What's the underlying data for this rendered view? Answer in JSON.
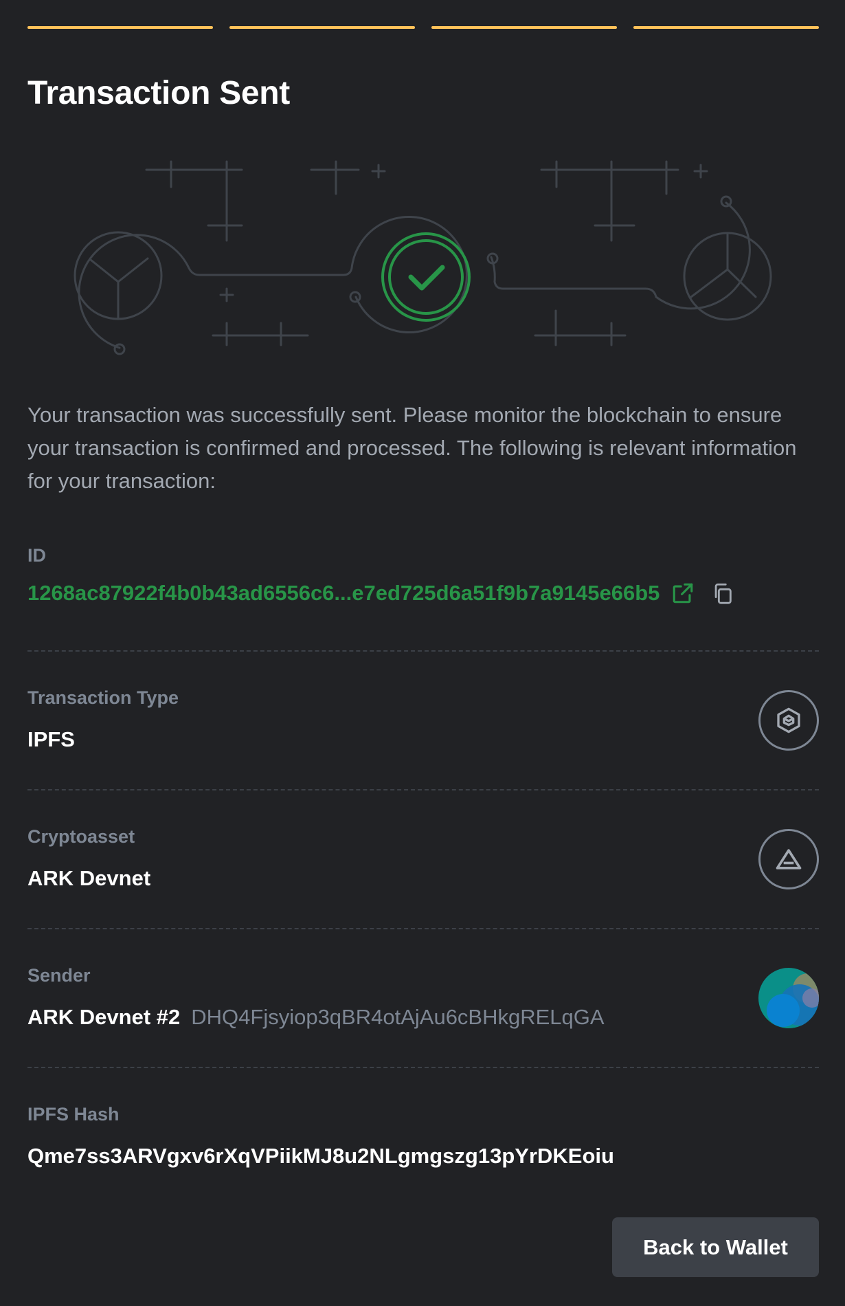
{
  "header": {
    "title": "Transaction Sent",
    "steps_completed": 4,
    "steps_total": 4,
    "step_color": "#ffc35a"
  },
  "description": "Your transaction was successfully sent. Please monitor the blockchain to ensure your transaction is confirmed and processed. The following is relevant information for your transaction:",
  "details": {
    "id": {
      "label": "ID",
      "value": "1268ac87922f4b0b43ad6556c6...e7ed725d6a51f9b7a9145e66b5",
      "icons": [
        "external-link-icon",
        "copy-icon"
      ]
    },
    "type": {
      "label": "Transaction Type",
      "value": "IPFS",
      "icon": "ipfs-cube-icon"
    },
    "cryptoasset": {
      "label": "Cryptoasset",
      "value": "ARK Devnet",
      "icon": "ark-logo-icon"
    },
    "sender": {
      "label": "Sender",
      "name": "ARK Devnet #2",
      "address": "DHQ4Fjsyiop3qBR4otAjAu6cBHkgRELqGA",
      "icon": "wallet-avatar"
    },
    "ipfs_hash": {
      "label": "IPFS Hash",
      "value": "Qme7ss3ARVgxv6rXqVPiikMJ8u2NLgmgszg13pYrDKEoiu"
    }
  },
  "footer": {
    "back_label": "Back to Wallet"
  },
  "colors": {
    "background": "#212225",
    "success": "#289548",
    "muted": "#7e8794",
    "divider": "#3c4047"
  }
}
